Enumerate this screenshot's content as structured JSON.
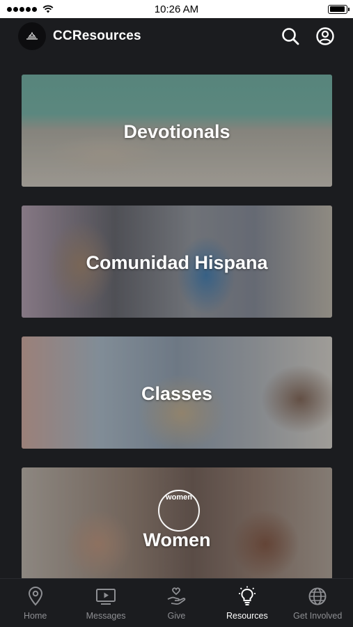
{
  "status_bar": {
    "time": "10:26 AM",
    "signal_icon": "signal-dots-icon",
    "wifi_icon": "wifi-icon",
    "battery_icon": "battery-icon",
    "battery_level": 0.95
  },
  "header": {
    "title": "CCResources",
    "logo_icon": "church-logo-icon",
    "search_icon": "search-icon",
    "profile_icon": "user-circle-icon"
  },
  "cards": [
    {
      "label": "Devotionals"
    },
    {
      "label": "Comunidad Hispana"
    },
    {
      "label": "Classes"
    },
    {
      "label": "Women",
      "badge": "women"
    }
  ],
  "tabbar": {
    "items": [
      {
        "label": "Home",
        "icon": "location-pin-icon"
      },
      {
        "label": "Messages",
        "icon": "play-screen-icon"
      },
      {
        "label": "Give",
        "icon": "hand-heart-icon"
      },
      {
        "label": "Resources",
        "icon": "lightbulb-icon",
        "active": true
      },
      {
        "label": "Get Involved",
        "icon": "globe-icon"
      }
    ]
  },
  "colors": {
    "background": "#1b1c1f",
    "active_tab": "#ffffff",
    "inactive_tab": "#8e8f93"
  }
}
